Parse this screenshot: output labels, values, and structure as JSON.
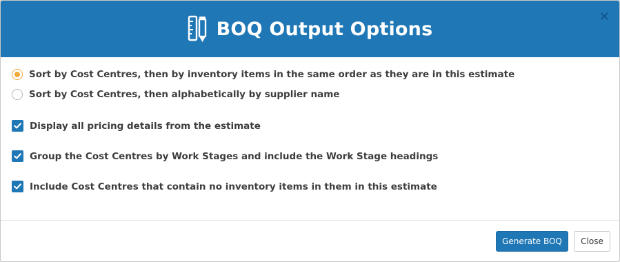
{
  "modal": {
    "title": "BOQ Output Options",
    "header_icon": "ruler-pencil-icon",
    "close_symbol": "×",
    "accent_color": "#1f77b5",
    "radio_accent_color": "#f2a93b"
  },
  "sort_options": [
    {
      "label": "Sort by Cost Centres, then by inventory items in the same order as they are in this estimate",
      "selected": true
    },
    {
      "label": "Sort by Cost Centres, then alphabetically by supplier name",
      "selected": false
    }
  ],
  "checkbox_options": [
    {
      "label": "Display all pricing details from the estimate",
      "checked": true
    },
    {
      "label": "Group the Cost Centres by Work Stages and include the Work Stage headings",
      "checked": true
    },
    {
      "label": "Include Cost Centres that contain no inventory items in them in this estimate",
      "checked": true
    }
  ],
  "footer": {
    "generate_label": "Generate BOQ",
    "close_label": "Close"
  }
}
